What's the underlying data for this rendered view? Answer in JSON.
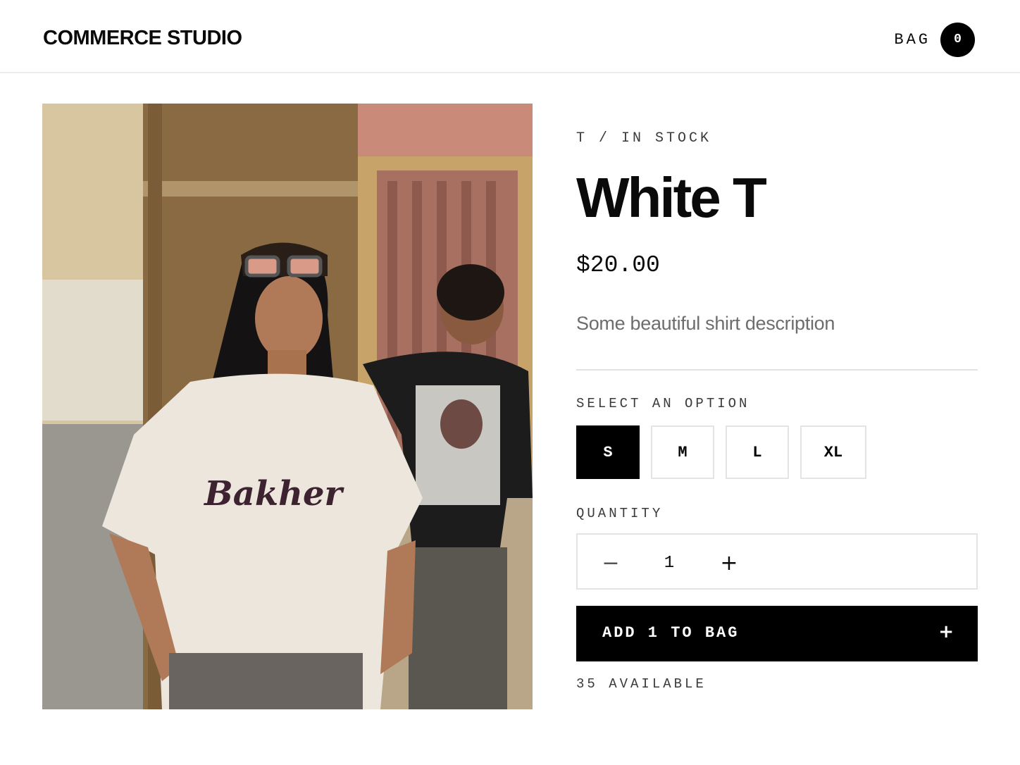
{
  "header": {
    "brand": "COMMERCE STUDIO",
    "bag_label": "BAG",
    "bag_count": "0"
  },
  "product": {
    "image_alt": "White T",
    "breadcrumb": "T / IN STOCK",
    "title": "White T",
    "price": "$20.00",
    "description": "Some beautiful shirt description",
    "print_text": "Bakher",
    "options": {
      "label": "SELECT AN OPTION",
      "sizes": [
        {
          "label": "S",
          "selected": true
        },
        {
          "label": "M",
          "selected": false
        },
        {
          "label": "L",
          "selected": false
        },
        {
          "label": "XL",
          "selected": false
        }
      ]
    },
    "quantity": {
      "label": "QUANTITY",
      "value": "1",
      "minus_icon": "minus-icon",
      "plus_icon": "plus-icon"
    },
    "add_button": {
      "label": "ADD 1 TO BAG",
      "icon": "plus-icon"
    },
    "availability": "35 AVAILABLE"
  },
  "colors": {
    "primary": "#000000",
    "background": "#ffffff",
    "muted_text": "#6d6d6d",
    "border": "#e4e4e4"
  }
}
